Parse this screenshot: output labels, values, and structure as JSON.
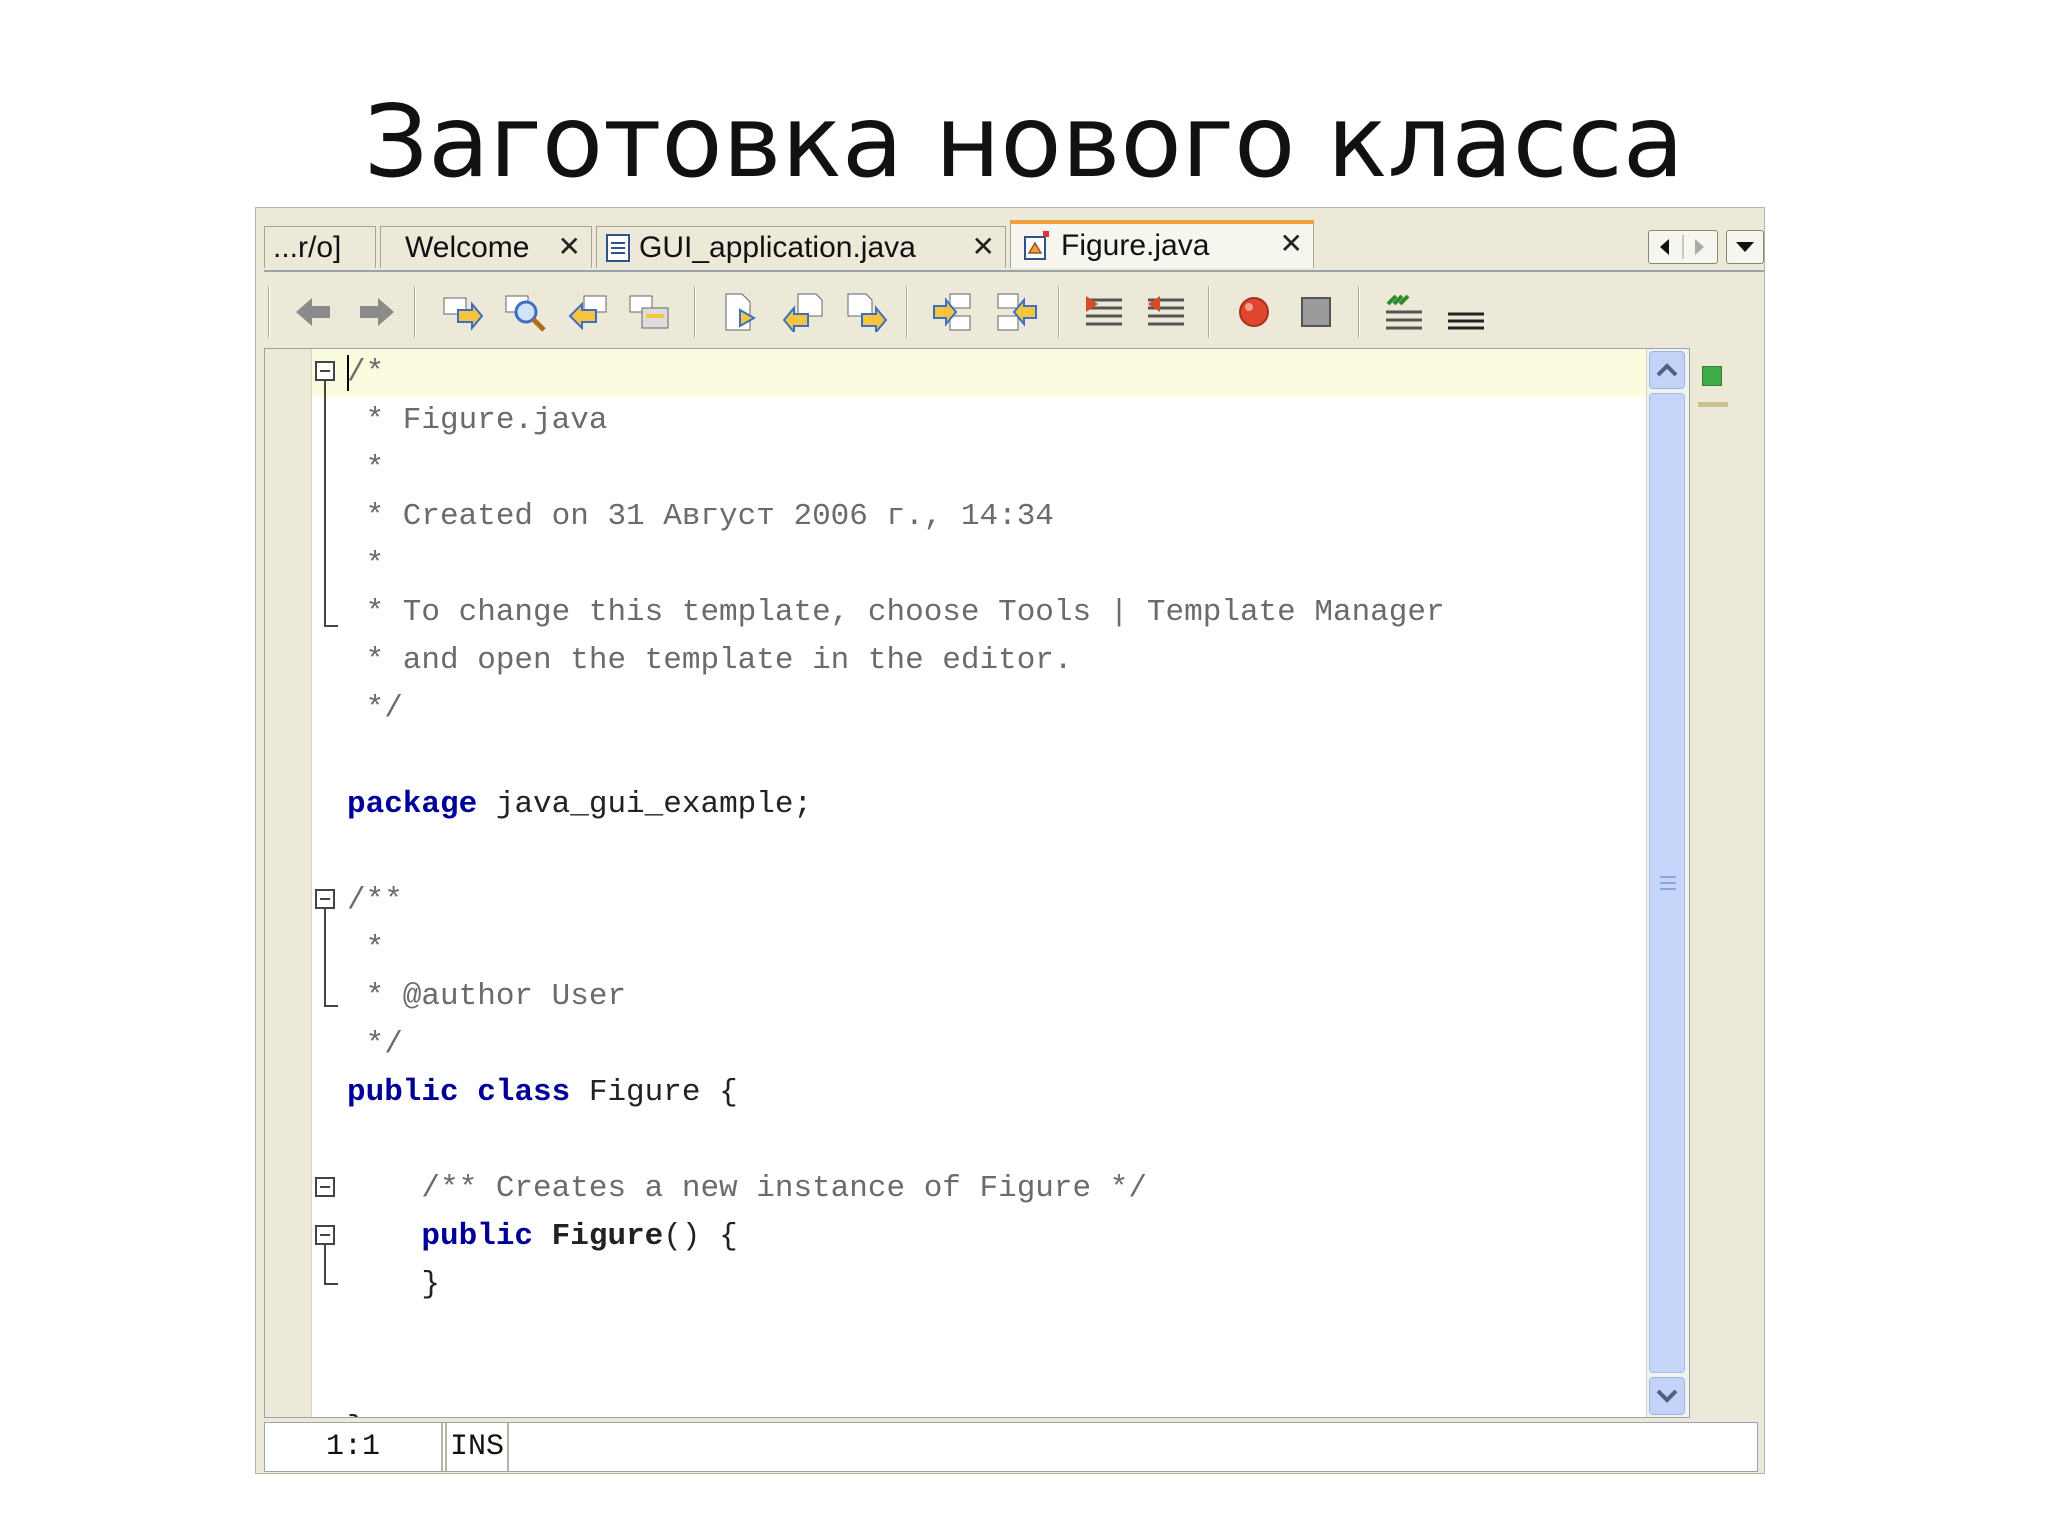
{
  "slide": {
    "title": "Заготовка нового класса"
  },
  "tabs": [
    {
      "label": "...r/o]",
      "active": false
    },
    {
      "label": "Welcome",
      "active": false
    },
    {
      "label": "GUI_application.java",
      "active": false
    },
    {
      "label": "Figure.java",
      "active": true
    }
  ],
  "tab_close_glyph": "✕",
  "toolbar_icons": [
    "back-icon",
    "forward-icon",
    "find-selection-icon",
    "find-icon",
    "find-previous-icon",
    "toggle-highlight-icon",
    "shift-left-icon",
    "previous-bookmark-icon",
    "next-bookmark-icon",
    "indent-icon",
    "unindent-icon",
    "comment-icon",
    "uncomment-icon",
    "record-macro-icon",
    "stop-macro-icon",
    "format-icon",
    "outline-icon"
  ],
  "code_lines": [
    [
      {
        "t": "/*",
        "c": "cmt"
      }
    ],
    [
      {
        "t": " * Figure.java",
        "c": "cmt"
      }
    ],
    [
      {
        "t": " *",
        "c": "cmt"
      }
    ],
    [
      {
        "t": " * Created on 31 Август 2006 г., 14:34",
        "c": "cmt"
      }
    ],
    [
      {
        "t": " *",
        "c": "cmt"
      }
    ],
    [
      {
        "t": " * To change this template, choose Tools | Template Manager",
        "c": "cmt"
      }
    ],
    [
      {
        "t": " * and open the template in the editor.",
        "c": "cmt"
      }
    ],
    [
      {
        "t": " */",
        "c": "cmt"
      }
    ],
    [],
    [
      {
        "t": "package",
        "c": "kw"
      },
      {
        "t": " java_gui_example;",
        "c": ""
      }
    ],
    [],
    [
      {
        "t": "/**",
        "c": "cmt"
      }
    ],
    [
      {
        "t": " *",
        "c": "cmt"
      }
    ],
    [
      {
        "t": " * @author User",
        "c": "cmt"
      }
    ],
    [
      {
        "t": " */",
        "c": "cmt"
      }
    ],
    [
      {
        "t": "public",
        "c": "kw"
      },
      {
        "t": " ",
        "c": ""
      },
      {
        "t": "class",
        "c": "kw"
      },
      {
        "t": " Figure {",
        "c": ""
      }
    ],
    [],
    [
      {
        "t": "    /** Creates a new instance of Figure */",
        "c": "cmt"
      }
    ],
    [
      {
        "t": "    ",
        "c": ""
      },
      {
        "t": "public",
        "c": "kw"
      },
      {
        "t": " ",
        "c": ""
      },
      {
        "t": "Figure",
        "c": "bold"
      },
      {
        "t": "() {",
        "c": ""
      }
    ],
    [
      {
        "t": "    }",
        "c": ""
      }
    ],
    [],
    [],
    [
      {
        "t": "}",
        "c": ""
      }
    ]
  ],
  "status": {
    "position": "1:1",
    "mode": "INS"
  },
  "colors": {
    "keyword": "#000099",
    "comment": "#6b6b6b",
    "active_tab_accent": "#f3a13b",
    "current_line": "#fbfbe0"
  }
}
